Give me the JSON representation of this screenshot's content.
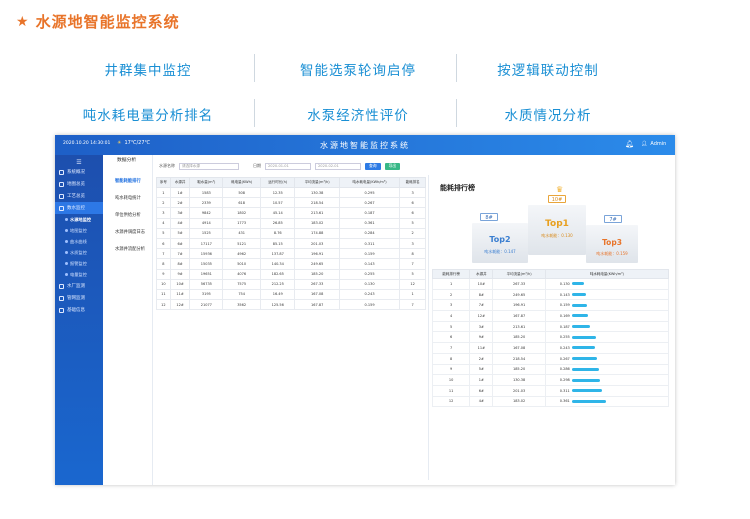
{
  "header": {
    "title": "水源地智能监控系统"
  },
  "features": [
    "井群集中监控",
    "智能选泵轮询启停",
    "按逻辑联动控制",
    "吨水耗电量分析排名",
    "水泵经济性评价",
    "水质情况分析"
  ],
  "app": {
    "time": "2020.10.20  14:30:01",
    "weather": "17℃/27℃",
    "title": "水源地智能监控系统",
    "user": "Admin",
    "sidebar": {
      "items": [
        {
          "label": "系统概况",
          "active": false
        },
        {
          "label": "地图总览",
          "active": false
        },
        {
          "label": "工艺总览",
          "active": false
        },
        {
          "label": "数水监控",
          "active": true
        }
      ],
      "subitems": [
        {
          "label": "水源地监控",
          "active": true
        },
        {
          "label": "地图监控",
          "active": false
        },
        {
          "label": "曲水曲线",
          "active": false
        },
        {
          "label": "水质监控",
          "active": false
        },
        {
          "label": "报警监控",
          "active": false
        },
        {
          "label": "电量监控",
          "active": false
        }
      ],
      "items2": [
        {
          "label": "水厂监测"
        },
        {
          "label": "管网监测"
        },
        {
          "label": "基础信息"
        }
      ]
    },
    "sub_tab": "数据分析",
    "sub_items": [
      {
        "label": "智能耗能排行",
        "active": true
      },
      {
        "label": "吨水耗电统计",
        "active": false
      },
      {
        "label": "单位供给分析",
        "active": false
      },
      {
        "label": "水源井调度日志",
        "active": false
      },
      {
        "label": "水源井流配分析",
        "active": false
      }
    ],
    "filter": {
      "label": "水源名称",
      "placeholder": "请选择水源",
      "date_label": "日期",
      "date_from": "2020-01-01",
      "date_to": "2020-02-01",
      "search": "查询",
      "export": "导出"
    },
    "table1": {
      "headers": [
        "序号",
        "水源井",
        "取水量(m³)",
        "耗电量(KWh)",
        "运行时长(h)",
        "平均流量(m³/h)",
        "吨水耗电量(KWh/m³)",
        "能耗排名"
      ],
      "rows": [
        [
          "1",
          "1#",
          "1583",
          "508",
          "12.35",
          "130.38",
          "0.295",
          "3"
        ],
        [
          "2",
          "2#",
          "2339",
          "618",
          "10.57",
          "218.54",
          "0.267",
          "6"
        ],
        [
          "3",
          "3#",
          "9842",
          "1802",
          "45.14",
          "213.61",
          "0.187",
          "6"
        ],
        [
          "4",
          "4#",
          "4914",
          "1773",
          "26.85",
          "183.02",
          "0.361",
          "5"
        ],
        [
          "5",
          "5#",
          "1525",
          "431",
          "8.76",
          "174.88",
          "0.284",
          "2"
        ],
        [
          "6",
          "6#",
          "17117",
          "5121",
          "85.15",
          "201.03",
          "0.311",
          "3"
        ],
        [
          "7",
          "7#",
          "15936",
          "4962",
          "137.87",
          "196.91",
          "0.159",
          "8"
        ],
        [
          "8",
          "8#",
          "15035",
          "5010",
          "140.34",
          "249.65",
          "0.143",
          "7"
        ],
        [
          "9",
          "9#",
          "19651",
          "4076",
          "182.65",
          "185.20",
          "0.255",
          "5"
        ],
        [
          "10",
          "10#",
          "56735",
          "7575",
          "212.25",
          "267.33",
          "0.130",
          "12"
        ],
        [
          "11",
          "11#",
          "3195",
          "754",
          "16.49",
          "167.08",
          "0.243",
          "1"
        ],
        [
          "12",
          "12#",
          "21077",
          "3562",
          "125.56",
          "167.87",
          "0.159",
          "7"
        ]
      ]
    },
    "ranking": {
      "title": "能耗排行榜",
      "podium": [
        {
          "place": "Top1",
          "well": "10#",
          "metric": "吨水耗能：0.130"
        },
        {
          "place": "Top2",
          "well": "8#",
          "metric": "吨水耗能：0.147"
        },
        {
          "place": "Top3",
          "well": "7#",
          "metric": "吨水耗能：0.159"
        }
      ]
    },
    "table2": {
      "headers": [
        "能耗排行榜",
        "水源井",
        "平均流量(m³/h)",
        "吨水耗电量(KWh/m³)"
      ],
      "rows": [
        [
          "1",
          "10#",
          "267.33",
          "0.130",
          0.13
        ],
        [
          "2",
          "8#",
          "249.65",
          "0.143",
          0.143
        ],
        [
          "3",
          "7#",
          "196.91",
          "0.159",
          0.159
        ],
        [
          "4",
          "12#",
          "167.87",
          "0.169",
          0.169
        ],
        [
          "5",
          "3#",
          "213.61",
          "0.187",
          0.187
        ],
        [
          "6",
          "9#",
          "185.20",
          "0.255",
          0.255
        ],
        [
          "7",
          "11#",
          "167.08",
          "0.243",
          0.243
        ],
        [
          "8",
          "2#",
          "218.54",
          "0.267",
          0.267
        ],
        [
          "9",
          "5#",
          "185.20",
          "0.286",
          0.286
        ],
        [
          "10",
          "1#",
          "130.38",
          "0.298",
          0.298
        ],
        [
          "11",
          "6#",
          "201.03",
          "0.311",
          0.311
        ],
        [
          "12",
          "4#",
          "183.02",
          "0.361",
          0.361
        ]
      ]
    }
  },
  "colors": {
    "accent": "#e8742a",
    "feature_text": "#1a8fd4",
    "topbar": "#2b7be0",
    "bar": "#2fb5e8"
  }
}
